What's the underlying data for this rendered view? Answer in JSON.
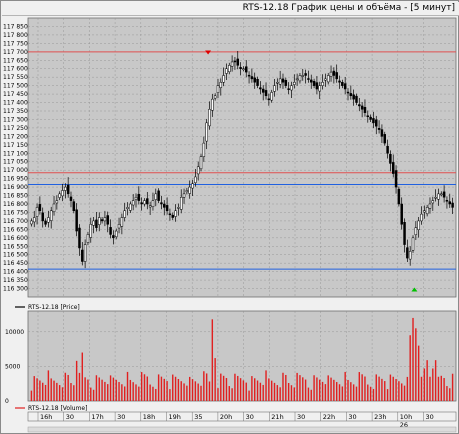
{
  "window": {
    "title": "RTS-12.18 График цены и объёма - [5 минут]"
  },
  "colors": {
    "background": "#c8c8c8",
    "grid": "#8e8e8e",
    "candle": "#000000",
    "red_line": "#e05050",
    "blue_line": "#2060e0",
    "volume": "#e02020",
    "marker_high": "#e00000",
    "marker_low": "#00c000"
  },
  "price_legend": {
    "icon": "black-line-icon",
    "label": "RTS-12.18 [Price]"
  },
  "volume_legend": {
    "icon": "red-line-icon",
    "label": "RTS-12.18 [Volume]"
  },
  "chart_data": [
    {
      "type": "candlestick",
      "series_name": "RTS-12.18 [Price]",
      "ylim": [
        116250,
        117900
      ],
      "y_ticks": [
        "117 850",
        "117 800",
        "117 750",
        "117 700",
        "117 650",
        "117 600",
        "117 550",
        "117 500",
        "117 450",
        "117 400",
        "117 350",
        "117 300",
        "117 250",
        "117 200",
        "117 150",
        "117 100",
        "117 050",
        "117 000",
        "116 950",
        "116 900",
        "116 850",
        "116 800",
        "116 750",
        "116 700",
        "116 650",
        "116 600",
        "116 550",
        "116 500",
        "116 450",
        "116 400",
        "116 350",
        "116 300"
      ],
      "horizontal_lines": [
        {
          "color": "red",
          "value": 117700
        },
        {
          "color": "red",
          "value": 116985
        },
        {
          "color": "blue",
          "value": 116915
        },
        {
          "color": "blue",
          "value": 116415
        }
      ],
      "markers": [
        {
          "type": "high",
          "value": 117690
        },
        {
          "type": "low",
          "value": 116300
        }
      ],
      "candles_approx": [
        116700,
        116720,
        116780,
        116760,
        116700,
        116680,
        116720,
        116760,
        116800,
        116820,
        116860,
        116880,
        116900,
        116860,
        116820,
        116760,
        116640,
        116540,
        116460,
        116560,
        116620,
        116680,
        116700,
        116660,
        116720,
        116700,
        116720,
        116680,
        116620,
        116600,
        116640,
        116680,
        116720,
        116760,
        116780,
        116800,
        116820,
        116840,
        116820,
        116800,
        116820,
        116800,
        116790,
        116820,
        116860,
        116820,
        116800,
        116780,
        116760,
        116740,
        116720,
        116760,
        116780,
        116840,
        116860,
        116880,
        116900,
        116920,
        116960,
        117020,
        117080,
        117160,
        117280,
        117360,
        117420,
        117440,
        117500,
        117520,
        117560,
        117600,
        117620,
        117640,
        117640,
        117620,
        117600,
        117600,
        117580,
        117560,
        117540,
        117520,
        117500,
        117480,
        117460,
        117440,
        117420,
        117460,
        117500,
        117520,
        117540,
        117520,
        117500,
        117480,
        117500,
        117520,
        117540,
        117560,
        117560,
        117560,
        117540,
        117520,
        117500,
        117480,
        117500,
        117520,
        117540,
        117560,
        117580,
        117560,
        117540,
        117520,
        117500,
        117480,
        117460,
        117440,
        117420,
        117400,
        117380,
        117360,
        117340,
        117320,
        117300,
        117280,
        117260,
        117240,
        117200,
        117160,
        117100,
        117040,
        116980,
        116900,
        116800,
        116680,
        116560,
        116480,
        116520,
        116600,
        116660,
        116700,
        116740,
        116760,
        116780,
        116800,
        116820,
        116840,
        116860,
        116860,
        116840,
        116820,
        116800,
        116780
      ]
    },
    {
      "type": "bar",
      "series_name": "RTS-12.18 [Volume]",
      "ylim": [
        0,
        13000
      ],
      "y_ticks": [
        "10000",
        "5000",
        "0"
      ],
      "peak_values": [
        7000,
        11800,
        12000
      ],
      "x_tick_labels": [
        "16h",
        "30",
        "17h",
        "30",
        "18h",
        "19h",
        "35",
        "20h",
        "30",
        "21h",
        "30",
        "22h",
        "30",
        "23h",
        "10h",
        "30"
      ],
      "x_tick_sub_labels": {
        "10h": "26"
      }
    }
  ]
}
